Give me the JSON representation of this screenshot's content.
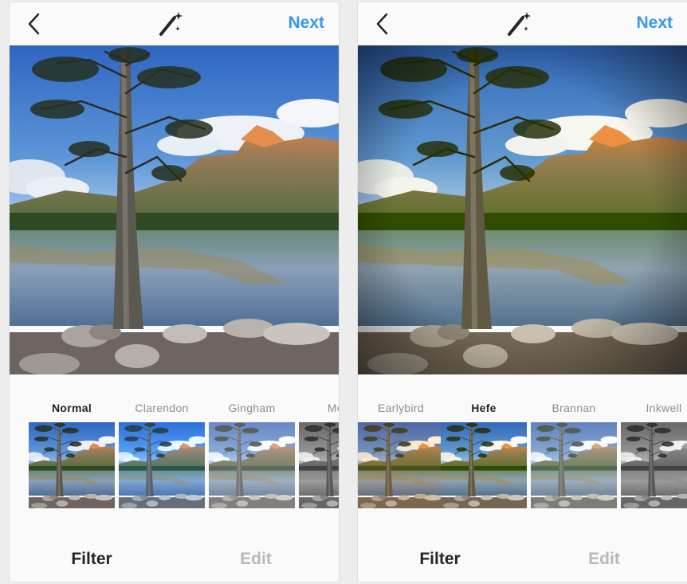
{
  "colors": {
    "accent": "#3897f0",
    "selected_text": "#262626",
    "unselected_text": "#8e8e8e",
    "inactive_tab": "#b8b8b8"
  },
  "screens": [
    {
      "header": {
        "back_icon": "chevron-left-icon",
        "wand_icon": "magic-wand-icon",
        "next_label": "Next"
      },
      "filters": [
        {
          "label": "Normal",
          "selected": true
        },
        {
          "label": "Clarendon",
          "selected": false
        },
        {
          "label": "Gingham",
          "selected": false
        },
        {
          "label": "Moon",
          "selected": false
        }
      ],
      "tabs": [
        {
          "label": "Filter",
          "active": true
        },
        {
          "label": "Edit",
          "active": false
        }
      ]
    },
    {
      "header": {
        "back_icon": "chevron-left-icon",
        "wand_icon": "magic-wand-icon",
        "next_label": "Next"
      },
      "filters": [
        {
          "label": "Earlybird",
          "selected": false
        },
        {
          "label": "Hefe",
          "selected": true
        },
        {
          "label": "Brannan",
          "selected": false
        },
        {
          "label": "Inkwell",
          "selected": false
        }
      ],
      "tabs": [
        {
          "label": "Filter",
          "active": true
        },
        {
          "label": "Edit",
          "active": false
        }
      ]
    }
  ]
}
